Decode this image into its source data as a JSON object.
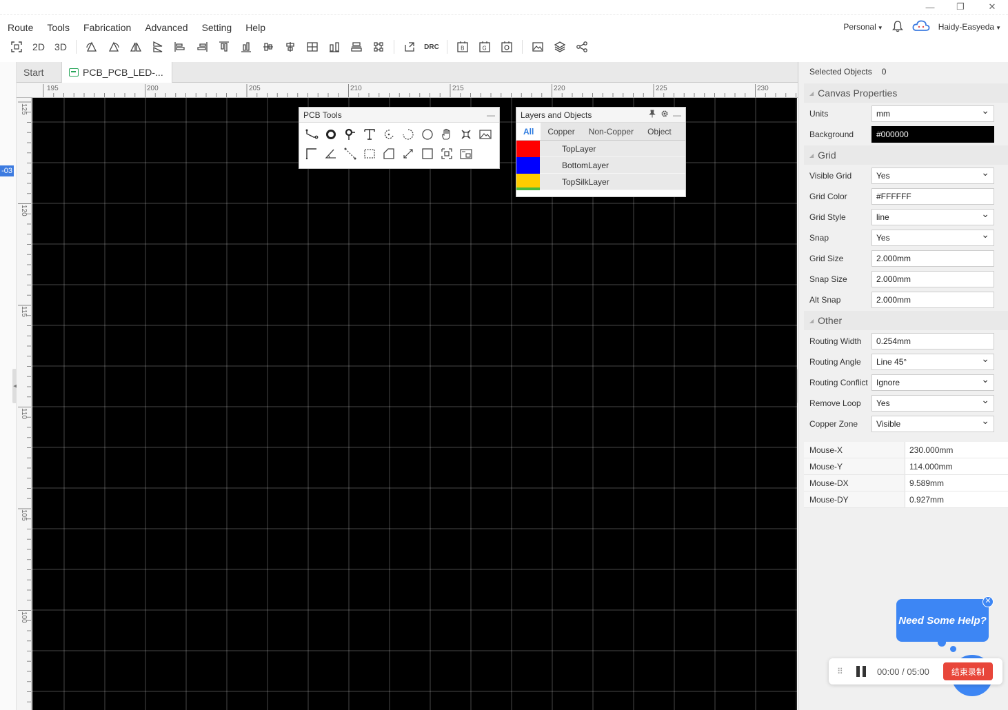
{
  "window": {
    "minimize_glyph": "—",
    "restore_glyph": "❐",
    "close_glyph": "✕"
  },
  "menu": [
    "Route",
    "Tools",
    "Fabrication",
    "Advanced",
    "Setting",
    "Help"
  ],
  "user": {
    "workspace": "Personal",
    "username": "Haidy-Easyeda"
  },
  "toolbar": {
    "view_2d": "2D",
    "view_3d": "3D",
    "drc": "DRC"
  },
  "tabs": [
    {
      "label": "Start"
    },
    {
      "label": "PCB_PCB_LED-..."
    }
  ],
  "left_badge": "-03",
  "ruler": {
    "horizontal": [
      "195",
      "200",
      "205",
      "210",
      "215",
      "220",
      "225",
      "230"
    ],
    "vertical": [
      "125",
      "120",
      "115",
      "110",
      "105",
      "100"
    ]
  },
  "canvas": {
    "background": "#000000",
    "grid_color": "#FFFFFF"
  },
  "pcb_tools": {
    "title": "PCB Tools",
    "minimize": "—"
  },
  "layers_panel": {
    "title": "Layers and Objects",
    "tabs": [
      "All",
      "Copper",
      "Non-Copper",
      "Object"
    ],
    "layers": [
      {
        "name": "TopLayer",
        "color": "#FF0000"
      },
      {
        "name": "BottomLayer",
        "color": "#0000FF"
      },
      {
        "name": "TopSilkLayer",
        "color": "#FFCC00"
      }
    ]
  },
  "right_panel": {
    "selected_label": "Selected Objects",
    "selected_count": "0",
    "canvas_section": "Canvas Properties",
    "grid_section": "Grid",
    "other_section": "Other",
    "props": {
      "units": {
        "label": "Units",
        "value": "mm"
      },
      "background": {
        "label": "Background",
        "value": "#000000"
      },
      "visible_grid": {
        "label": "Visible Grid",
        "value": "Yes"
      },
      "grid_color": {
        "label": "Grid Color",
        "value": "#FFFFFF"
      },
      "grid_style": {
        "label": "Grid Style",
        "value": "line"
      },
      "snap": {
        "label": "Snap",
        "value": "Yes"
      },
      "grid_size": {
        "label": "Grid Size",
        "value": "2.000mm"
      },
      "snap_size": {
        "label": "Snap Size",
        "value": "2.000mm"
      },
      "alt_snap": {
        "label": "Alt Snap",
        "value": "2.000mm"
      },
      "routing_width": {
        "label": "Routing Width",
        "value": "0.254mm"
      },
      "routing_angle": {
        "label": "Routing Angle",
        "value": "Line 45°"
      },
      "routing_conflict": {
        "label": "Routing Conflict",
        "value": "Ignore"
      },
      "remove_loop": {
        "label": "Remove Loop",
        "value": "Yes"
      },
      "copper_zone": {
        "label": "Copper Zone",
        "value": "Visible"
      }
    },
    "mouse": [
      {
        "key": "Mouse-X",
        "value": "230.000mm"
      },
      {
        "key": "Mouse-Y",
        "value": "114.000mm"
      },
      {
        "key": "Mouse-DX",
        "value": "9.589mm"
      },
      {
        "key": "Mouse-DY",
        "value": "0.927mm"
      }
    ]
  },
  "help": {
    "text": "Need Some Help?",
    "close": "✕"
  },
  "recorder": {
    "time": "00:00 / 05:00",
    "stop_label": "结束录制"
  }
}
